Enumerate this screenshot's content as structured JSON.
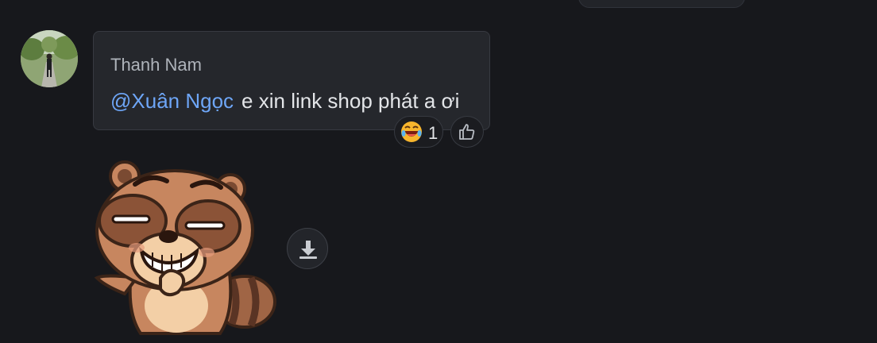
{
  "message": {
    "sender_name": "Thanh Nam",
    "mention": "@Xuân Ngọc",
    "text": "e xin link shop phát a ơi",
    "reaction": {
      "emoji": "laughing-face-icon",
      "count": "1"
    },
    "like_icon": "thumbs-up-icon"
  },
  "sticker": {
    "name": "raccoon-sticker",
    "download_icon": "download-icon"
  },
  "colors": {
    "background": "#17181c",
    "bubble": "#25272c",
    "mention": "#6ea6f7",
    "text": "#e3e5e8",
    "sender": "#aeb3ba"
  }
}
